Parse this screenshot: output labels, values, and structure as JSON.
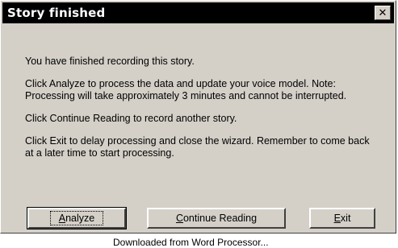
{
  "window": {
    "title": "Story finished",
    "close_glyph": "✕"
  },
  "body": {
    "paragraphs": [
      "You have finished recording this story.",
      "Click Analyze to process the data and update your voice model. Note: Processing will take approximately 3 minutes and cannot be interrupted.",
      "Click Continue Reading to record another story.",
      "Click Exit to delay processing and close the wizard. Remember to come back at a later time to start processing."
    ]
  },
  "buttons": {
    "analyze": {
      "mnemonic": "A",
      "rest": "nalyze"
    },
    "continue": {
      "mnemonic": "C",
      "rest": "ontinue Reading"
    },
    "exit": {
      "mnemonic": "E",
      "rest": "xit"
    }
  },
  "footer": {
    "text": "Downloaded from Word Processor..."
  }
}
